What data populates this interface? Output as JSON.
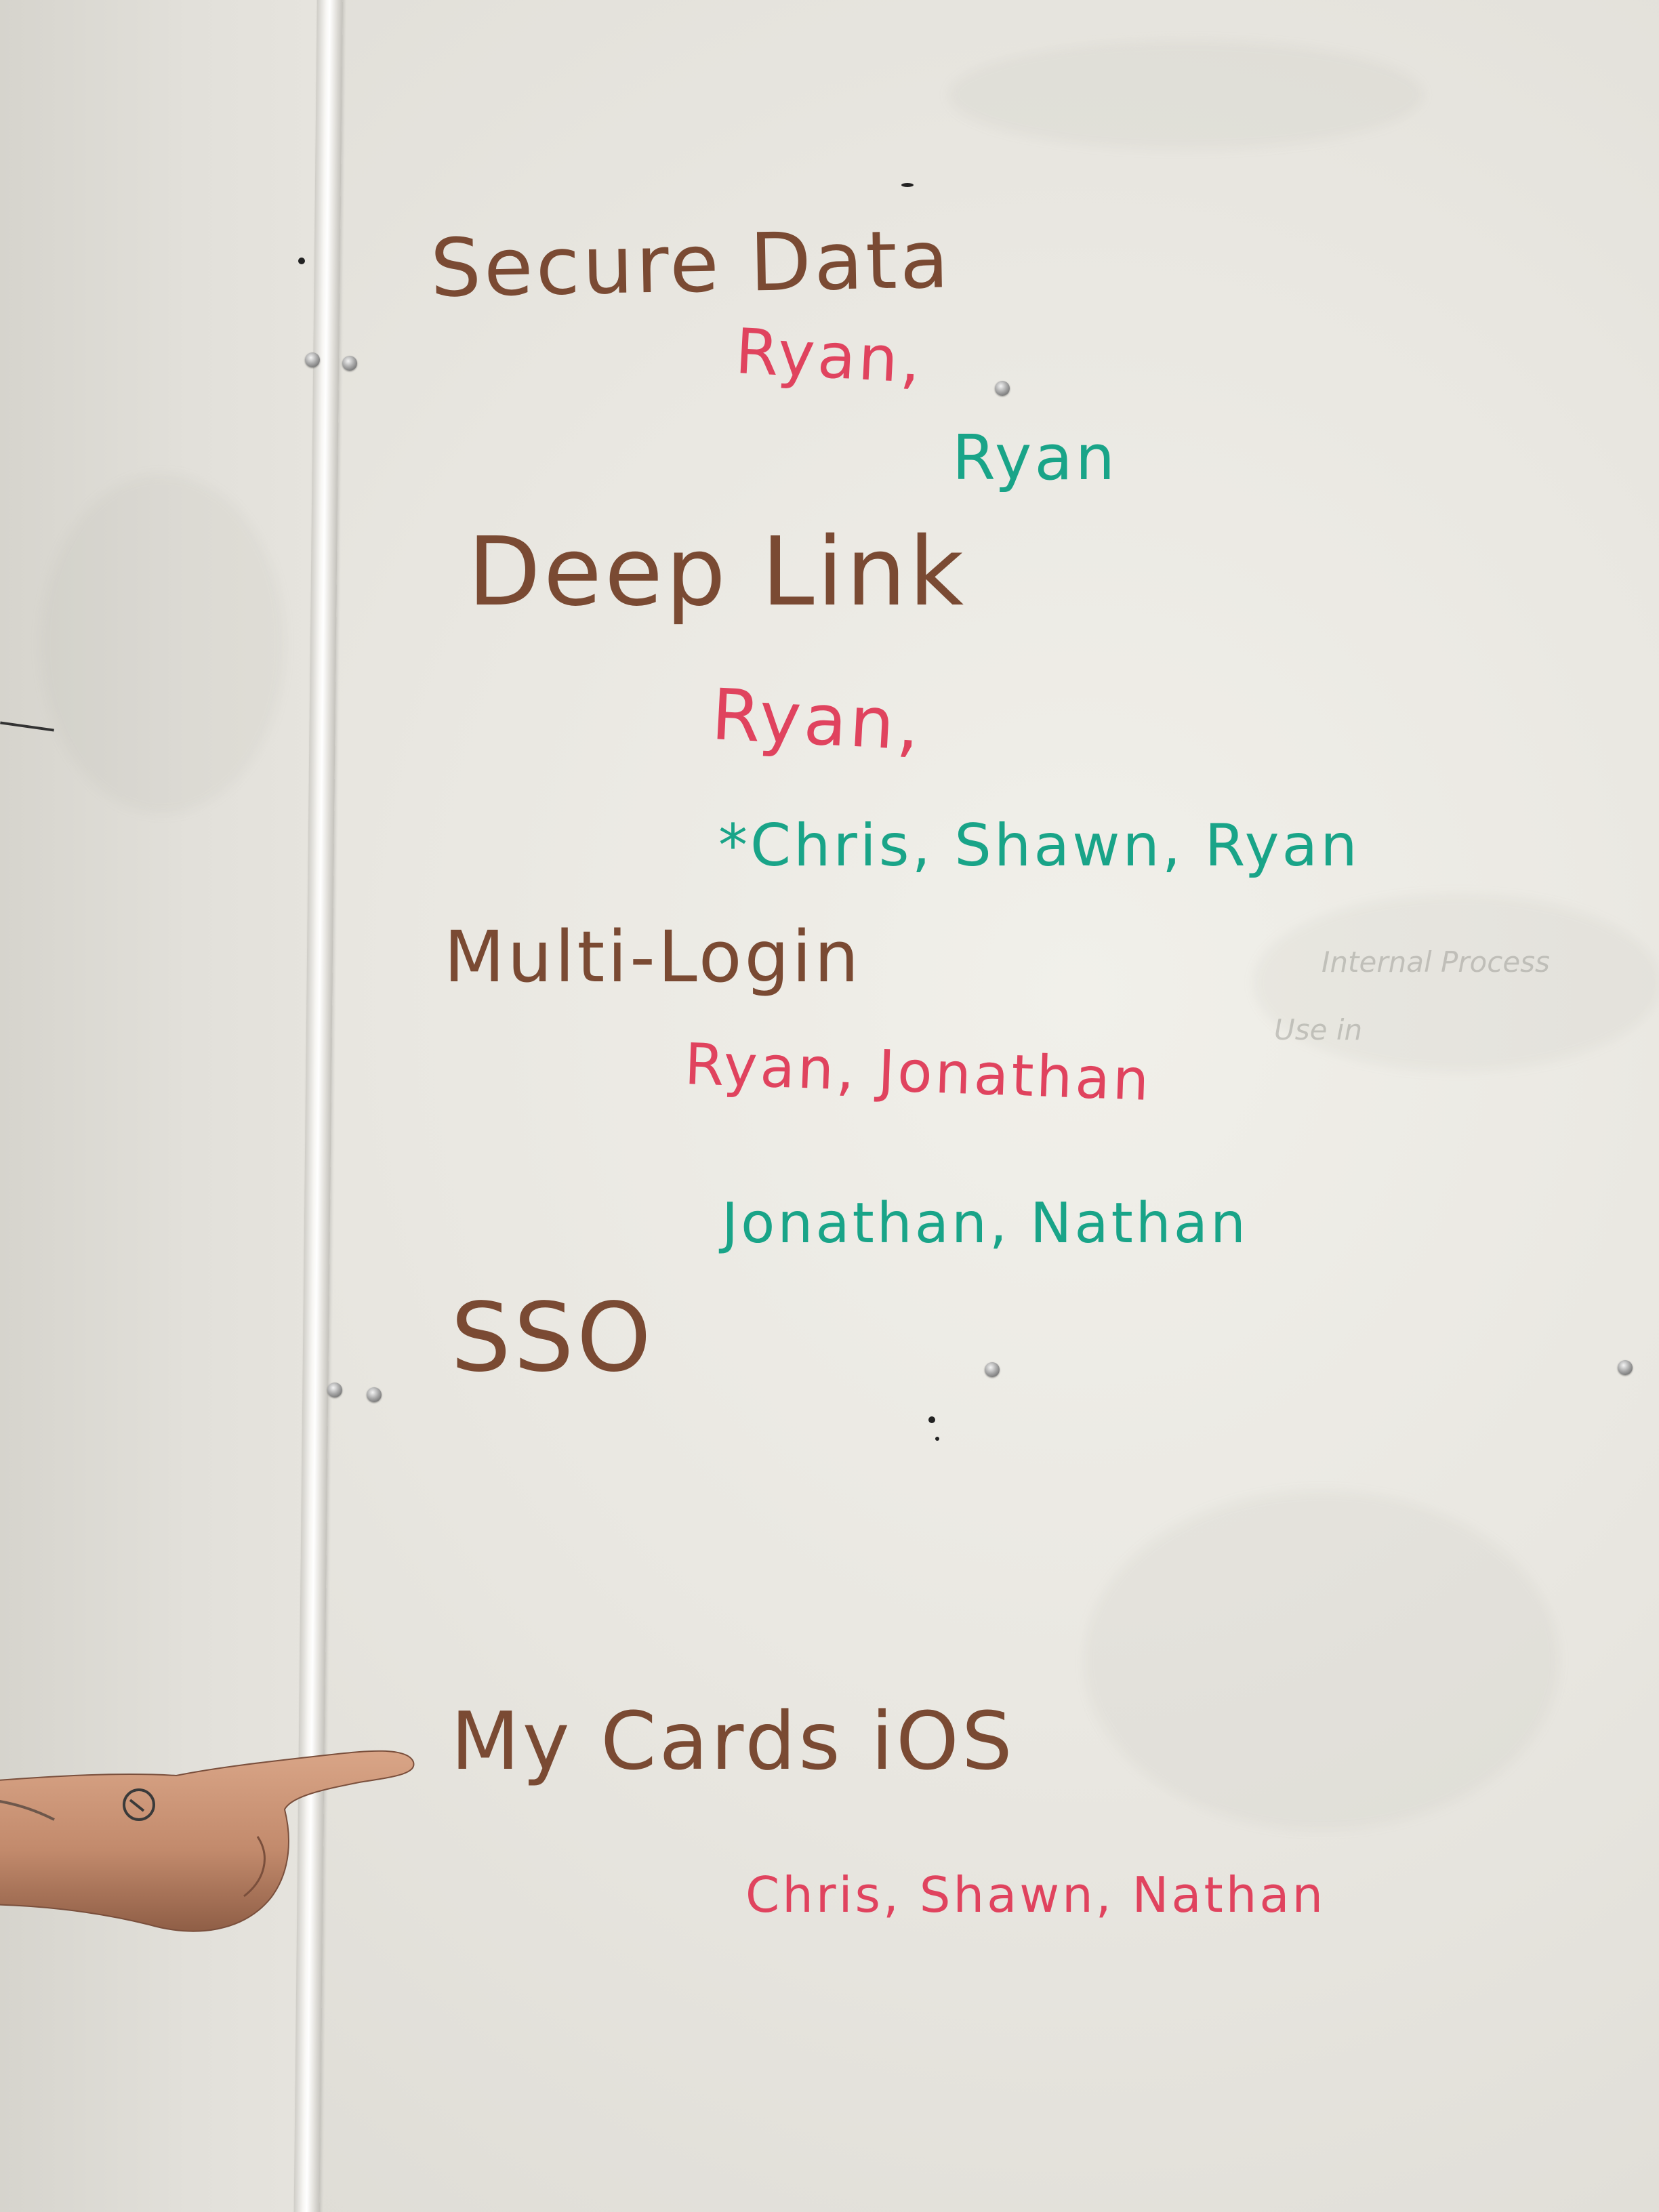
{
  "whiteboard": {
    "sections": [
      {
        "title": "Secure Data",
        "lines": [
          {
            "text": "Ryan,",
            "color": "#e0435e"
          },
          {
            "text": "Ryan",
            "color": "#19a488"
          }
        ]
      },
      {
        "title": "Deep Link",
        "lines": [
          {
            "text": "Ryan,",
            "color": "#e0435e"
          },
          {
            "text": "*Chris, Shawn, Ryan",
            "color": "#19a488"
          }
        ]
      },
      {
        "title": "Multi-Login",
        "lines": [
          {
            "text": "Ryan, Jonathan",
            "color": "#e0435e"
          },
          {
            "text": "Jonathan, Nathan",
            "color": "#19a488"
          }
        ]
      },
      {
        "title": "SSO",
        "lines": []
      },
      {
        "title": "My Cards iOS",
        "lines": [
          {
            "text": "Chris, Shawn, Nathan",
            "color": "#e0435e"
          }
        ]
      }
    ],
    "faint_text": [
      "Internal Process",
      "Use in"
    ]
  },
  "colors": {
    "heading": "#7a4a33",
    "red_marker": "#e0435e",
    "teal_marker": "#19a488",
    "board": "#e9e7e1",
    "skin": "#c89274"
  },
  "icons": [
    "screw-icon",
    "pointing-hand"
  ]
}
